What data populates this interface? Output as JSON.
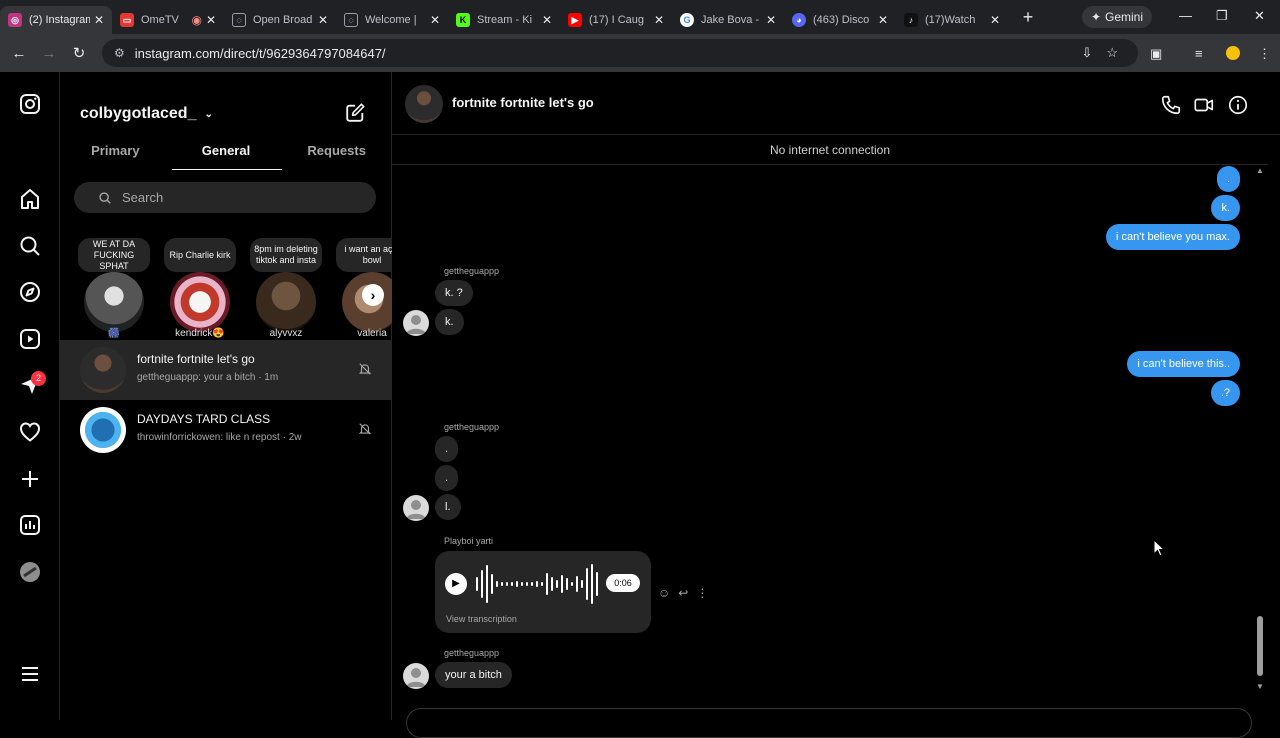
{
  "browser": {
    "tabs": [
      {
        "label": "(2) Instagram",
        "favicon_color": "#c13584",
        "icon": "instagram-icon",
        "active": true
      },
      {
        "label": "OmeTV",
        "favicon_color": "#e53935",
        "icon": "ometv-icon",
        "active": false
      },
      {
        "label": "Open Broad",
        "favicon_color": "#5f6368",
        "icon": "globe-icon",
        "active": false
      },
      {
        "label": "Welcome |",
        "favicon_color": "#5f6368",
        "icon": "globe-icon",
        "active": false
      },
      {
        "label": "Stream - Ki",
        "favicon_color": "#53fc18",
        "icon": "kick-icon",
        "active": false
      },
      {
        "label": "(17) I Caug",
        "favicon_color": "#ff0000",
        "icon": "youtube-icon",
        "active": false
      },
      {
        "label": "Jake Bova -",
        "favicon_color": "#4285f4",
        "icon": "google-icon",
        "active": false
      },
      {
        "label": "(463) Disco",
        "favicon_color": "#5865f2",
        "icon": "discord-icon",
        "active": false
      },
      {
        "label": "(17)Watch",
        "favicon_color": "#111111",
        "icon": "tiktok-icon",
        "active": false
      }
    ],
    "gemini_label": "Gemini",
    "url": "instagram.com/direct/t/9629364797084647/"
  },
  "sidebar": {
    "items": [
      "instagram-logo-icon",
      "home-icon",
      "search-icon",
      "explore-icon",
      "reels-icon",
      "messages-icon",
      "notifications-icon",
      "create-icon",
      "dashboard-icon",
      "profile-avatar",
      "more-menu-icon"
    ],
    "messages_badge": "2"
  },
  "inbox": {
    "username": "colbygotlaced_",
    "tabs": [
      "Primary",
      "General",
      "Requests"
    ],
    "active_tab": "General",
    "search_placeholder": "Search",
    "notes": [
      {
        "text": "WE AT DA FUCKING SPHAT",
        "name": "🎆"
      },
      {
        "text": "Rip Charlie kirk",
        "name": "kendrick😍"
      },
      {
        "text": "8pm im deleting tiktok and insta",
        "name": "alyvvxz"
      },
      {
        "text": "i want an açai bowl",
        "name": "valeria"
      }
    ],
    "threads": [
      {
        "title": "fortnite fortnite let's go",
        "preview": "gettheguappp: your a bitch · 1m",
        "active": true
      },
      {
        "title": "DAYDAYS TARD CLASS",
        "preview": "throwinforrickowen: like n repost · 2w",
        "active": false
      }
    ]
  },
  "conversation": {
    "title": "fortnite fortnite let's go",
    "offline_notice": "No internet connection",
    "messages": {
      "out_1": ".",
      "out_2": "k.",
      "out_3": "i can't believe you max.",
      "sender_1": "gettheguappp",
      "in_1": "k. ?",
      "in_2": "k.",
      "out_4": "i can't believe this..",
      "out_5": ".?",
      "sender_2": "gettheguappp",
      "in_3": ".",
      "in_4": ".",
      "in_5": "l.",
      "sender_3": "Playboi yarti",
      "voice_duration": "0:06",
      "voice_transcription": "View transcription",
      "sender_4": "gettheguappp",
      "in_6": "your a bitch"
    }
  }
}
